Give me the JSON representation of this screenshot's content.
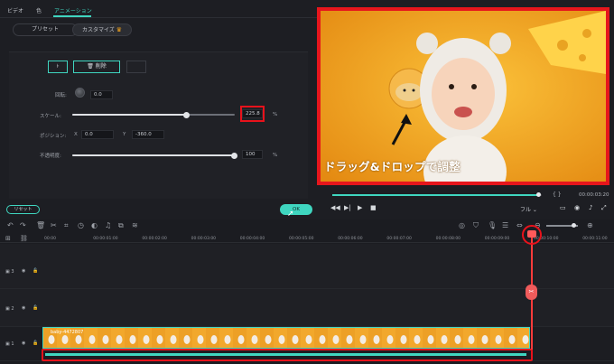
{
  "tabs": [
    {
      "label": "ビデオ"
    },
    {
      "label": "色"
    },
    {
      "label": "アニメーション"
    }
  ],
  "segments": {
    "preset": "プリセット",
    "custom": "カスタマイズ"
  },
  "controls": {
    "delete_label": "削除",
    "rotate_label": "回転:",
    "rotate_value": "0.0",
    "scale_label": "スケール:",
    "scale_value": "225.8",
    "scale_unit": "%",
    "scale_level": 0.7,
    "position_label": "ポジション:",
    "x_label": "X",
    "x_value": "0.0",
    "y_label": "Y",
    "y_value": "-360.0",
    "opacity_label": "不透明度:",
    "opacity_value": "100",
    "opacity_unit": "%",
    "opacity_level": 1.0
  },
  "buttons": {
    "reset": "リセット",
    "ok": "OK"
  },
  "preview": {
    "caption": "ドラッグ&ドロップで調整",
    "timecode": "00:00:03:20",
    "quality": "フル",
    "progress": 0.98
  },
  "timeline": {
    "ticks": [
      "00:00",
      "00:00:01:00",
      "00:00:02:00",
      "00:00:03:00",
      "00:00:04:00",
      "00:00:05:00",
      "00:00:06:00",
      "00:00:07:00",
      "00:00:08:00",
      "00:00:09:00",
      "00:00:10:00",
      "00:00:11:00"
    ],
    "tracks": [
      {
        "label": "3"
      },
      {
        "label": "2"
      },
      {
        "label": "1"
      }
    ],
    "clip_label": "baby-4472807"
  },
  "colors": {
    "accent": "#3fd6c0",
    "highlight": "#e8121b"
  },
  "icons": [
    "undo-icon",
    "redo-icon",
    "delete-icon",
    "cut-icon",
    "crop-icon",
    "speed-icon",
    "color-icon",
    "audio-icon",
    "split-icon",
    "play-icon",
    "stop-icon",
    "snapshot-icon",
    "fullscreen-icon",
    "zoom-in-icon",
    "zoom-out-icon",
    "eye-icon",
    "lock-icon",
    "crown-icon",
    "cursor-icon"
  ]
}
